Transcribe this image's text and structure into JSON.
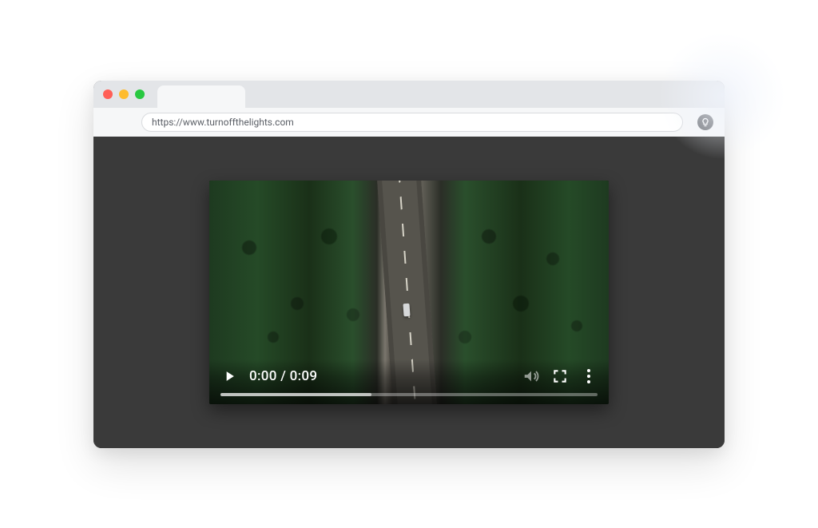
{
  "browser": {
    "url": "https://www.turnoffthelights.com",
    "extension_icon": "lamp-icon"
  },
  "video": {
    "time_display": "0:00 / 0:09",
    "current_time": "0:00",
    "duration": "0:09",
    "buffered_percent": 40,
    "played_percent": 0,
    "volume_state": "muted"
  }
}
